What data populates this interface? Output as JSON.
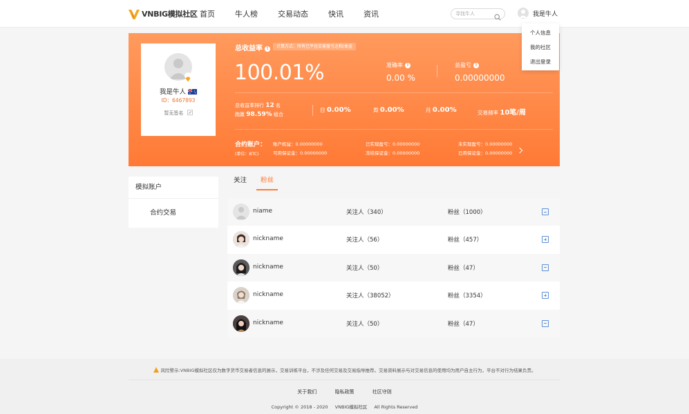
{
  "header": {
    "logo_text": "VNBIG模拟社区",
    "nav": [
      "首页",
      "牛人榜",
      "交易动态",
      "快讯",
      "资讯"
    ],
    "search_placeholder": "寻找牛人",
    "user_name": "我是牛人"
  },
  "dropdown": [
    "个人信息",
    "我的社区",
    "退出登录"
  ],
  "profile": {
    "name": "我是牛人",
    "id_label": "ID：6467893",
    "signature": "暂无签名"
  },
  "banner": {
    "title": "总收益率",
    "calc_note": "计算方式：所有已平仓交易盈亏之和/本金",
    "total_return": "100.01%",
    "accuracy_label": "准确率",
    "accuracy_value": "0.00 %",
    "total_pnl_label": "总盈亏",
    "total_pnl_value": "0.00000000",
    "rank_label": "总收益率排行",
    "rank_value": "12",
    "rank_unit": "名",
    "beat_label": "跑赢",
    "beat_value": "98.59%",
    "beat_unit": "组合",
    "day_label": "日",
    "day_value": "0.00%",
    "week_label": "周",
    "week_value": "0.00%",
    "month_label": "月",
    "month_value": "0.00%",
    "freq_label": "交易频率",
    "freq_value": "10笔/周",
    "account_title": "合约账户：",
    "account_unit": "(单位：BTC)",
    "account_equity": "账户权益：0.00000000",
    "available_margin": "可用保证金：0.00000000",
    "realized_pnl": "已实现盈亏：0.00000000",
    "frozen_margin": "冻结保证金：0.00000000",
    "unrealized_pnl": "未实现盈亏：0.00000000",
    "used_margin": "已用保证金：0.00000000"
  },
  "sidebar": {
    "title": "模拟账户",
    "items": [
      "合约交易"
    ]
  },
  "tabs": [
    "关注",
    "粉丝"
  ],
  "list": [
    {
      "name": "niame",
      "following": "关注人（340）",
      "fans": "粉丝（1000）",
      "action": "minus"
    },
    {
      "name": "nickname",
      "following": "关注人（56）",
      "fans": "粉丝（457）",
      "action": "plus"
    },
    {
      "name": "nickname",
      "following": "关注人（50）",
      "fans": "粉丝（47）",
      "action": "minus"
    },
    {
      "name": "nickname",
      "following": "关注人（38052）",
      "fans": "粉丝（3354）",
      "action": "plus"
    },
    {
      "name": "nickname",
      "following": "关注人（50）",
      "fans": "粉丝（47）",
      "action": "minus"
    }
  ],
  "footer": {
    "risk": "风险警示:VNBIG模拟社区仅为数字货币交易者信息的展示，交易训练平台，不涉及任何交易及交易指导推荐。交易资料展示与对交易信息的使用均为用户自主行为，平台不对行为结果负责。",
    "links": [
      "关于我们",
      "隐私政策",
      "社区守则"
    ],
    "copyright": "Copyright © 2018 - 2020",
    "brand": "VNBIG模拟社区",
    "rights": "All Rights Reserved"
  },
  "colors": {
    "accent": "#ff7a35",
    "link_blue": "#5b8fd6"
  }
}
